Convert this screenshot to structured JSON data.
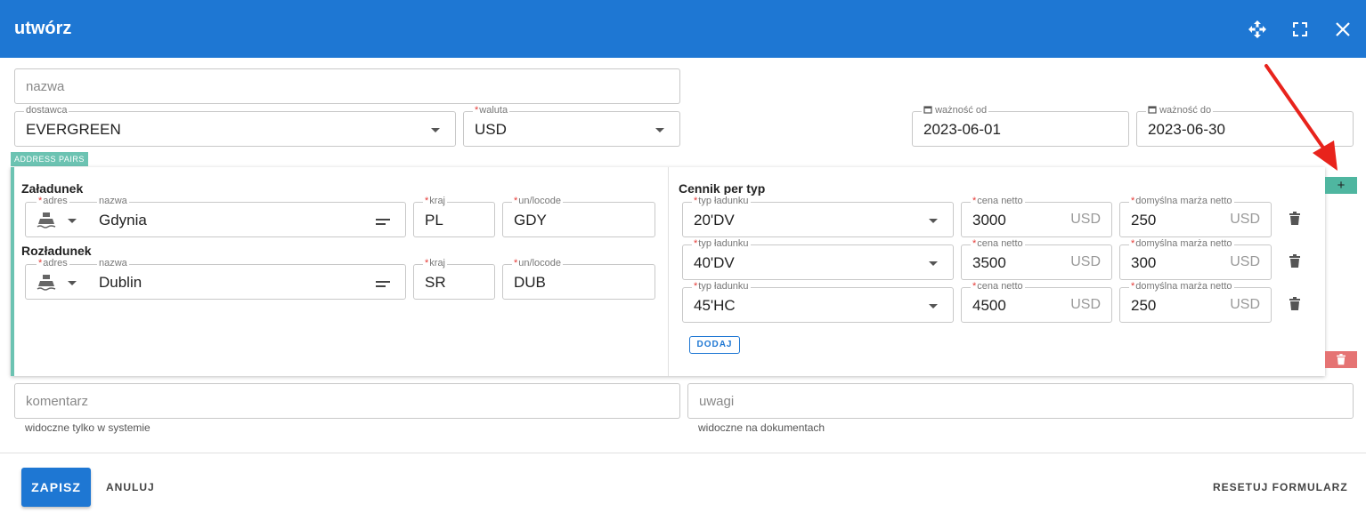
{
  "dialog": {
    "title": "utwórz",
    "icons": {
      "move": "move-icon",
      "fullscreen": "fullscreen-icon",
      "close": "close-icon"
    }
  },
  "form": {
    "name_placeholder": "nazwa",
    "supplier": {
      "label": "dostawca",
      "value": "EVERGREEN"
    },
    "currency": {
      "label": "waluta",
      "value": "USD"
    },
    "valid_from": {
      "label": "ważność od",
      "value": "2023-06-01"
    },
    "valid_to": {
      "label": "ważność do",
      "value": "2023-06-30"
    }
  },
  "address_pairs": {
    "chip": "ADDRESS PAIRS",
    "loading": {
      "title": "Załadunek",
      "address_label": "adres",
      "name_label": "nazwa",
      "name_value": "Gdynia",
      "country_label": "kraj",
      "country_value": "PL",
      "locode_label": "un/locode",
      "locode_value": "GDY"
    },
    "unloading": {
      "title": "Rozładunek",
      "address_label": "adres",
      "name_label": "nazwa",
      "name_value": "Dublin",
      "country_label": "kraj",
      "country_value": "SR",
      "locode_label": "un/locode",
      "locode_value": "DUB"
    },
    "pricing": {
      "title": "Cennik per typ",
      "type_label": "typ ładunku",
      "price_label": "cena netto",
      "margin_label": "domyślna marża netto",
      "currency": "USD",
      "rows": [
        {
          "type": "20'DV",
          "price": "3000",
          "margin": "250"
        },
        {
          "type": "40'DV",
          "price": "3500",
          "margin": "300"
        },
        {
          "type": "45'HC",
          "price": "4500",
          "margin": "250"
        }
      ],
      "add_label": "DODAJ"
    },
    "add_pair_label": "+"
  },
  "notes": {
    "comment_placeholder": "komentarz",
    "comment_hint": "widoczne tylko w systemie",
    "remarks_placeholder": "uwagi",
    "remarks_hint": "widoczne na dokumentach"
  },
  "footer": {
    "save": "ZAPISZ",
    "cancel": "ANULUJ",
    "reset": "RESETUJ FORMULARZ"
  },
  "colors": {
    "header": "#1e77d3",
    "accent_teal": "#4fb6a0",
    "danger": "#e57373",
    "annotation_arrow": "#e8231c"
  }
}
